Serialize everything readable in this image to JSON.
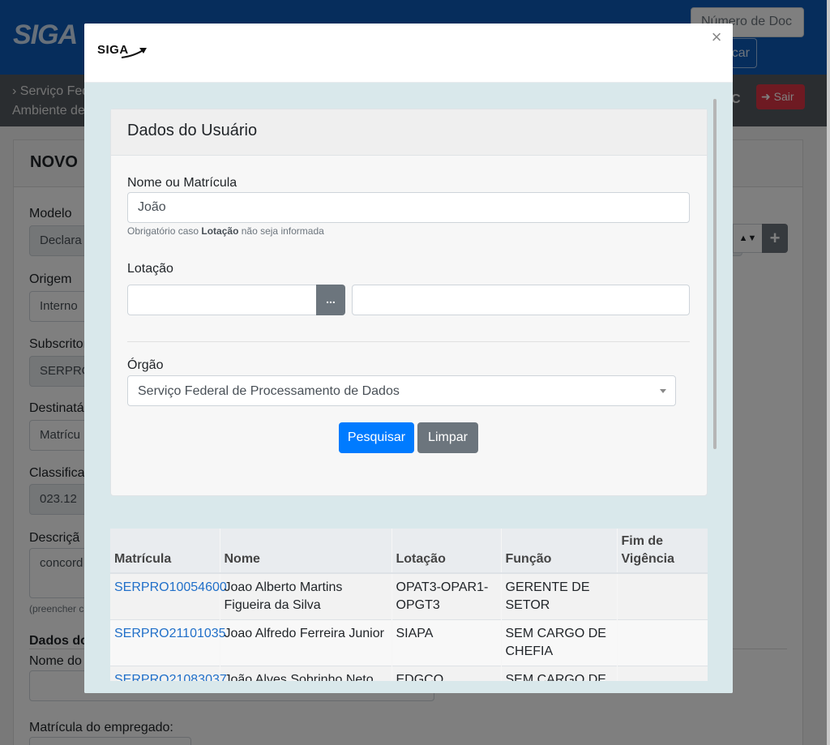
{
  "background": {
    "logo": "SIGA",
    "search_placeholder": "Número de Doc",
    "search_button": "car",
    "breadcrumb_line1": "Serviço Fed",
    "breadcrumb_line2": "Ambiente de",
    "user_initials": "C",
    "exit_label": "Sair",
    "card_title": "NOVO",
    "fields": {
      "modelo_label": "Modelo",
      "modelo_value": "Declara",
      "origem_label": "Origem",
      "origem_value": "Interno",
      "subscritor_label": "Subscritor",
      "subscritor_value": "SERPRO",
      "destinatario_label": "Destinatá",
      "destinatario_value": "Matrícu",
      "classificacao_label": "Classifica",
      "classificacao_value": "023.12",
      "descricao_label": "Descriçã",
      "descricao_value": "concord",
      "descricao_help": "(preencher c",
      "dados_label": "Dados do",
      "nome_label": "Nome do",
      "matricula_label": "Matrícula do empregado:"
    }
  },
  "modal": {
    "logo": "SIGA",
    "close_symbol": "×",
    "card_title": "Dados do Usuário",
    "nome_label": "Nome ou Matrícula",
    "nome_value": "João",
    "help_prefix": "Obrigatório caso ",
    "help_bold": "Lotação",
    "help_suffix": " não seja informada",
    "lotacao_label": "Lotação",
    "lotacao_code": "",
    "lotacao_desc": "",
    "lotacao_button": "...",
    "orgao_label": "Órgão",
    "orgao_value": "Serviço Federal de Processamento de Dados",
    "search_button": "Pesquisar",
    "clear_button": "Limpar"
  },
  "table": {
    "headers": [
      "Matrícula",
      "Nome",
      "Lotação",
      "Função",
      "Fim de Vigência"
    ],
    "rows": [
      {
        "matricula": "SERPRO10054600",
        "nome": "Joao Alberto Martins Figueira da Silva",
        "lotacao": "OPAT3-OPAR1-OPGT3",
        "funcao": "GERENTE DE SETOR",
        "fim": ""
      },
      {
        "matricula": "SERPRO21101035",
        "nome": "Joao Alfredo Ferreira Junior",
        "lotacao": "SIAPA",
        "funcao": "SEM CARGO DE CHEFIA",
        "fim": ""
      },
      {
        "matricula": "SERPRO21083037",
        "nome": "João Alves Sobrinho Neto",
        "lotacao": "EDGCO",
        "funcao": "SEM CARGO DE CHEFIA",
        "fim": ""
      }
    ]
  }
}
